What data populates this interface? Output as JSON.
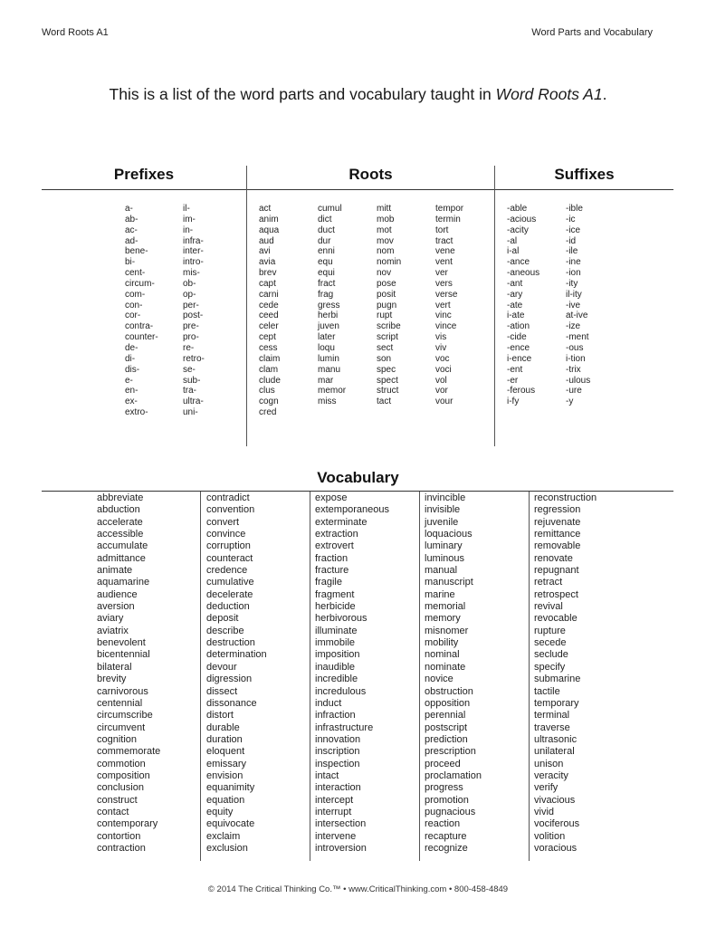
{
  "header": {
    "left": "Word Roots A1",
    "right": "Word Parts and Vocabulary"
  },
  "intro": {
    "text_before": "This is a list of the word parts and vocabulary taught in ",
    "title_italic": "Word Roots A1",
    "text_after": "."
  },
  "sections": {
    "prefixes": {
      "title": "Prefixes",
      "columns": [
        [
          "a-",
          "ab-",
          "ac-",
          "ad-",
          "bene-",
          "bi-",
          "cent-",
          "circum-",
          "com-",
          "con-",
          "cor-",
          "contra-",
          "counter-",
          "de-",
          "di-",
          "dis-",
          "e-",
          "en-",
          "ex-",
          "extro-"
        ],
        [
          "il-",
          "im-",
          "in-",
          "infra-",
          "inter-",
          "intro-",
          "mis-",
          "ob-",
          "op-",
          "per-",
          "post-",
          "pre-",
          "pro-",
          "re-",
          "retro-",
          "se-",
          "sub-",
          "tra-",
          "ultra-",
          "uni-"
        ]
      ]
    },
    "roots": {
      "title": "Roots",
      "columns": [
        [
          "act",
          "anim",
          "aqua",
          "aud",
          "avi",
          "avia",
          "brev",
          "capt",
          "carni",
          "cede",
          "ceed",
          "celer",
          "cept",
          "cess",
          "claim",
          "clam",
          "clude",
          "clus",
          "cogn",
          "cred"
        ],
        [
          "cumul",
          "dict",
          "duct",
          "dur",
          "enni",
          "equ",
          "equi",
          "fract",
          "frag",
          "gress",
          "herbi",
          "juven",
          "later",
          "loqu",
          "lumin",
          "manu",
          "mar",
          "memor",
          "miss"
        ],
        [
          "mitt",
          "mob",
          "mot",
          "mov",
          "nom",
          "nomin",
          "nov",
          "pose",
          "posit",
          "pugn",
          "rupt",
          "scribe",
          "script",
          "sect",
          "son",
          "spec",
          "spect",
          "struct",
          "tact"
        ],
        [
          "tempor",
          "termin",
          "tort",
          "tract",
          "vene",
          "vent",
          "ver",
          "vers",
          "verse",
          "vert",
          "vinc",
          "vince",
          "vis",
          "viv",
          "voc",
          "voci",
          "vol",
          "vor",
          "vour"
        ]
      ]
    },
    "suffixes": {
      "title": "Suffixes",
      "columns": [
        [
          "-able",
          "-acious",
          "-acity",
          "-al",
          "i-al",
          "-ance",
          "-aneous",
          "-ant",
          "-ary",
          "-ate",
          "i-ate",
          "-ation",
          "-cide",
          "-ence",
          "i-ence",
          "-ent",
          "-er",
          "-ferous",
          "i-fy"
        ],
        [
          "-ible",
          "-ic",
          "-ice",
          "-id",
          "-ile",
          "-ine",
          "-ion",
          "-ity",
          "il-ity",
          "-ive",
          "at-ive",
          "-ize",
          "-ment",
          "-ous",
          "i-tion",
          "-trix",
          "-ulous",
          "-ure",
          "-y"
        ]
      ]
    }
  },
  "vocabulary": {
    "title": "Vocabulary",
    "columns": [
      [
        "abbreviate",
        "abduction",
        "accelerate",
        "accessible",
        "accumulate",
        "admittance",
        "animate",
        "aquamarine",
        "audience",
        "aversion",
        "aviary",
        "aviatrix",
        "benevolent",
        "bicentennial",
        "bilateral",
        "brevity",
        "carnivorous",
        "centennial",
        "circumscribe",
        "circumvent",
        "cognition",
        "commemorate",
        "commotion",
        "composition",
        "conclusion",
        "construct",
        "contact",
        "contemporary",
        "contortion",
        "contraction"
      ],
      [
        "contradict",
        "convention",
        "convert",
        "convince",
        "corruption",
        "counteract",
        "credence",
        "cumulative",
        "decelerate",
        "deduction",
        "deposit",
        "describe",
        "destruction",
        "determination",
        "devour",
        "digression",
        "dissect",
        "dissonance",
        "distort",
        "durable",
        "duration",
        "eloquent",
        "emissary",
        "envision",
        "equanimity",
        "equation",
        "equity",
        "equivocate",
        "exclaim",
        "exclusion"
      ],
      [
        "expose",
        "extemporaneous",
        "exterminate",
        "extraction",
        "extrovert",
        "fraction",
        "fracture",
        "fragile",
        "fragment",
        "herbicide",
        "herbivorous",
        "illuminate",
        "immobile",
        "imposition",
        "inaudible",
        "incredible",
        "incredulous",
        "induct",
        "infraction",
        "infrastructure",
        "innovation",
        "inscription",
        "inspection",
        "intact",
        "interaction",
        "intercept",
        "interrupt",
        "intersection",
        "intervene",
        "introversion"
      ],
      [
        "invincible",
        "invisible",
        "juvenile",
        "loquacious",
        "luminary",
        "luminous",
        "manual",
        "manuscript",
        "marine",
        "memorial",
        "memory",
        "misnomer",
        "mobility",
        "nominal",
        "nominate",
        "novice",
        "obstruction",
        "opposition",
        "perennial",
        "postscript",
        "prediction",
        "prescription",
        "proceed",
        "proclamation",
        "progress",
        "promotion",
        "pugnacious",
        "reaction",
        "recapture",
        "recognize"
      ],
      [
        "reconstruction",
        "regression",
        "rejuvenate",
        "remittance",
        "removable",
        "renovate",
        "repugnant",
        "retract",
        "retrospect",
        "revival",
        "revocable",
        "rupture",
        "secede",
        "seclude",
        "specify",
        "submarine",
        "tactile",
        "temporary",
        "terminal",
        "traverse",
        "ultrasonic",
        "unilateral",
        "unison",
        "veracity",
        "verify",
        "vivacious",
        "vivid",
        "vociferous",
        "volition",
        "voracious"
      ]
    ]
  },
  "footer": {
    "text": "© 2014 The Critical Thinking Co.™ • www.CriticalThinking.com • 800-458-4849"
  }
}
